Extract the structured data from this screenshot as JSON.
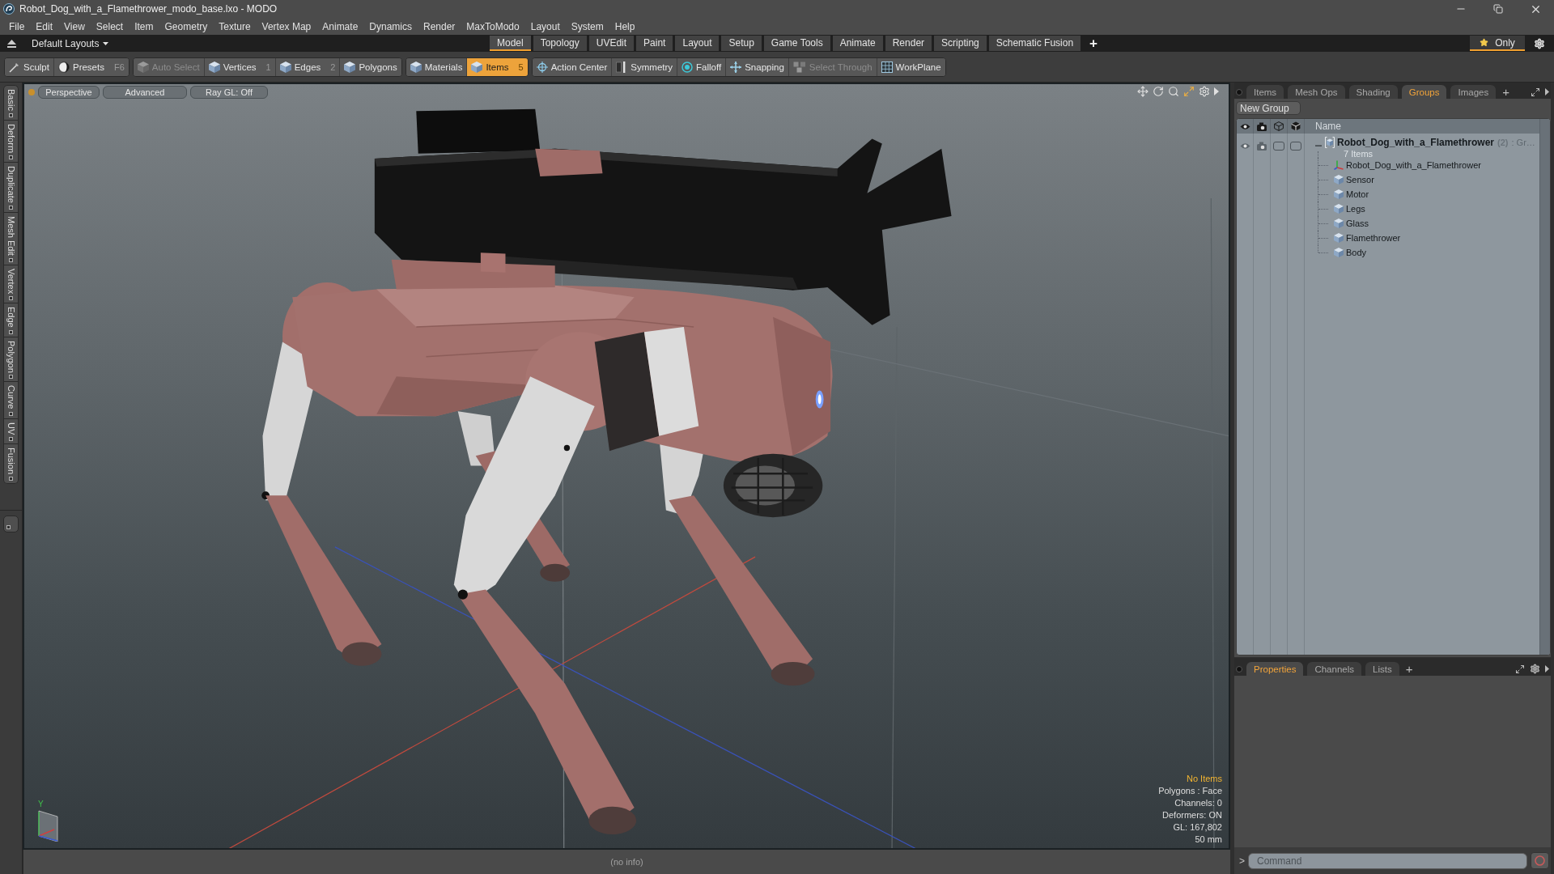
{
  "window": {
    "title": "Robot_Dog_with_a_Flamethrower_modo_base.lxo - MODO"
  },
  "menu": [
    "File",
    "Edit",
    "View",
    "Select",
    "Item",
    "Geometry",
    "Texture",
    "Vertex Map",
    "Animate",
    "Dynamics",
    "Render",
    "MaxToModo",
    "Layout",
    "System",
    "Help"
  ],
  "layout_bar": {
    "layouts_menu": "Default Layouts",
    "tabs": [
      {
        "label": "Model",
        "selected": true
      },
      {
        "label": "Topology",
        "selected": false
      },
      {
        "label": "UVEdit",
        "selected": false
      },
      {
        "label": "Paint",
        "selected": false
      },
      {
        "label": "Layout",
        "selected": false
      },
      {
        "label": "Setup",
        "selected": false
      },
      {
        "label": "Game Tools",
        "selected": false
      },
      {
        "label": "Animate",
        "selected": false
      },
      {
        "label": "Render",
        "selected": false
      },
      {
        "label": "Scripting",
        "selected": false
      },
      {
        "label": "Schematic Fusion",
        "selected": false
      }
    ],
    "add_tab": "+",
    "only_toggle": {
      "label": "Only",
      "on": true
    }
  },
  "toolbar": {
    "groups": [
      {
        "items": [
          {
            "label": "Sculpt",
            "selected": false,
            "disabled": false
          },
          {
            "label": "Presets",
            "shortcut": "F6",
            "selected": false,
            "disabled": false
          }
        ]
      },
      {
        "items": [
          {
            "label": "Auto Select",
            "selected": false,
            "disabled": true
          },
          {
            "label": "Vertices",
            "shortcut": "1",
            "selected": false,
            "disabled": false
          },
          {
            "label": "Edges",
            "shortcut": "2",
            "selected": false,
            "disabled": false
          },
          {
            "label": "Polygons",
            "selected": false,
            "disabled": false
          }
        ]
      },
      {
        "items": [
          {
            "label": "Materials",
            "selected": false,
            "disabled": false
          },
          {
            "label": "Items",
            "shortcut": "5",
            "selected": true,
            "disabled": false
          }
        ]
      },
      {
        "items": [
          {
            "label": "Action Center",
            "selected": false,
            "disabled": false
          },
          {
            "label": "Symmetry",
            "selected": false,
            "disabled": false
          },
          {
            "label": "Falloff",
            "selected": false,
            "disabled": false
          },
          {
            "label": "Snapping",
            "selected": false,
            "disabled": false
          },
          {
            "label": "Select Through",
            "selected": false,
            "disabled": true
          },
          {
            "label": "WorkPlane",
            "selected": false,
            "disabled": false
          }
        ]
      }
    ]
  },
  "tool_tabs": [
    {
      "label": "Basic"
    },
    {
      "label": "Deform"
    },
    {
      "label": "Duplicate"
    },
    {
      "label": "Mesh Edit"
    },
    {
      "label": "Vertex"
    },
    {
      "label": "Edge"
    },
    {
      "label": "Polygon"
    },
    {
      "label": "Curve"
    },
    {
      "label": "UV"
    },
    {
      "label": "Fusion"
    }
  ],
  "viewport": {
    "view_buttons": [
      "Perspective",
      "Advanced",
      "Ray GL: Off"
    ],
    "axis_label": "Y",
    "info": [
      {
        "text": "No Items",
        "kind": "highlight"
      },
      {
        "text": "Polygons : Face",
        "kind": "plain"
      },
      {
        "text": "Channels: 0",
        "kind": "plain"
      },
      {
        "text": "Deformers: ON",
        "kind": "plain"
      },
      {
        "text": "GL: 167,802",
        "kind": "plain"
      },
      {
        "text": "50 mm",
        "kind": "plain"
      }
    ]
  },
  "status_bar": {
    "text": "(no info)"
  },
  "items_panel": {
    "tabs": [
      {
        "label": "Items",
        "selected": false
      },
      {
        "label": "Mesh Ops",
        "selected": false
      },
      {
        "label": "Shading",
        "selected": false
      },
      {
        "label": "Groups",
        "selected": true
      },
      {
        "label": "Images",
        "selected": false
      }
    ],
    "add_tab": "+",
    "new_group_button": "New Group",
    "name_column": "Name",
    "tree": [
      {
        "name": "Robot_Dog_with_a_Flamethrower",
        "count": "(2)",
        "suffix": ": Gr…",
        "subtitle": "7 Items",
        "expanded": true,
        "children": [
          {
            "name": "Robot_Dog_with_a_Flamethrower",
            "kind": "locator"
          },
          {
            "name": "Sensor",
            "kind": "mesh"
          },
          {
            "name": "Motor",
            "kind": "mesh"
          },
          {
            "name": "Legs",
            "kind": "mesh"
          },
          {
            "name": "Glass",
            "kind": "mesh"
          },
          {
            "name": "Flamethrower",
            "kind": "mesh"
          },
          {
            "name": "Body",
            "kind": "mesh"
          }
        ]
      }
    ]
  },
  "properties_panel": {
    "tabs": [
      {
        "label": "Properties",
        "selected": true
      },
      {
        "label": "Channels",
        "selected": false
      },
      {
        "label": "Lists",
        "selected": false
      }
    ],
    "add_tab": "+"
  },
  "command": {
    "prompt": ">",
    "placeholder": "Command"
  }
}
